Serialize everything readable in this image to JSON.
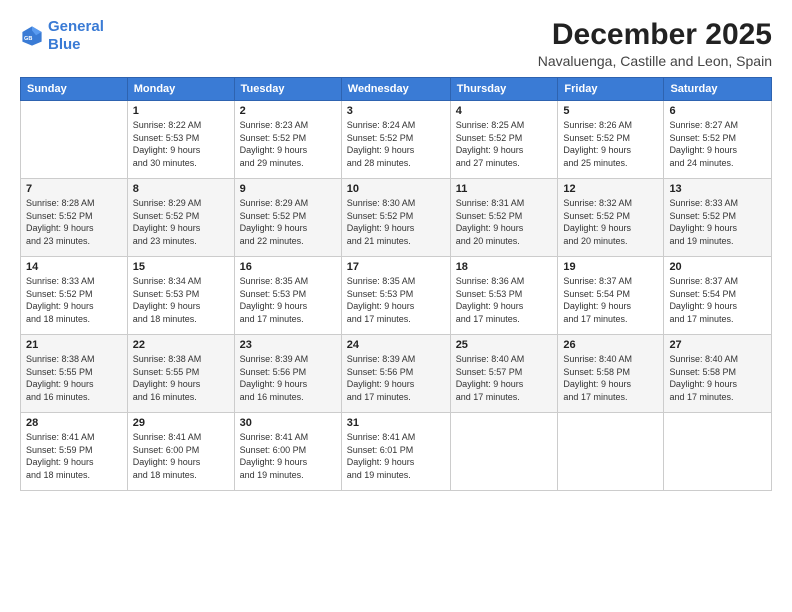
{
  "header": {
    "logo_line1": "General",
    "logo_line2": "Blue",
    "title": "December 2025",
    "subtitle": "Navaluenga, Castille and Leon, Spain"
  },
  "calendar": {
    "days_of_week": [
      "Sunday",
      "Monday",
      "Tuesday",
      "Wednesday",
      "Thursday",
      "Friday",
      "Saturday"
    ],
    "weeks": [
      [
        {
          "day": "",
          "info": ""
        },
        {
          "day": "1",
          "info": "Sunrise: 8:22 AM\nSunset: 5:53 PM\nDaylight: 9 hours\nand 30 minutes."
        },
        {
          "day": "2",
          "info": "Sunrise: 8:23 AM\nSunset: 5:52 PM\nDaylight: 9 hours\nand 29 minutes."
        },
        {
          "day": "3",
          "info": "Sunrise: 8:24 AM\nSunset: 5:52 PM\nDaylight: 9 hours\nand 28 minutes."
        },
        {
          "day": "4",
          "info": "Sunrise: 8:25 AM\nSunset: 5:52 PM\nDaylight: 9 hours\nand 27 minutes."
        },
        {
          "day": "5",
          "info": "Sunrise: 8:26 AM\nSunset: 5:52 PM\nDaylight: 9 hours\nand 25 minutes."
        },
        {
          "day": "6",
          "info": "Sunrise: 8:27 AM\nSunset: 5:52 PM\nDaylight: 9 hours\nand 24 minutes."
        }
      ],
      [
        {
          "day": "7",
          "info": "Sunrise: 8:28 AM\nSunset: 5:52 PM\nDaylight: 9 hours\nand 23 minutes."
        },
        {
          "day": "8",
          "info": "Sunrise: 8:29 AM\nSunset: 5:52 PM\nDaylight: 9 hours\nand 23 minutes."
        },
        {
          "day": "9",
          "info": "Sunrise: 8:29 AM\nSunset: 5:52 PM\nDaylight: 9 hours\nand 22 minutes."
        },
        {
          "day": "10",
          "info": "Sunrise: 8:30 AM\nSunset: 5:52 PM\nDaylight: 9 hours\nand 21 minutes."
        },
        {
          "day": "11",
          "info": "Sunrise: 8:31 AM\nSunset: 5:52 PM\nDaylight: 9 hours\nand 20 minutes."
        },
        {
          "day": "12",
          "info": "Sunrise: 8:32 AM\nSunset: 5:52 PM\nDaylight: 9 hours\nand 20 minutes."
        },
        {
          "day": "13",
          "info": "Sunrise: 8:33 AM\nSunset: 5:52 PM\nDaylight: 9 hours\nand 19 minutes."
        }
      ],
      [
        {
          "day": "14",
          "info": "Sunrise: 8:33 AM\nSunset: 5:52 PM\nDaylight: 9 hours\nand 18 minutes."
        },
        {
          "day": "15",
          "info": "Sunrise: 8:34 AM\nSunset: 5:53 PM\nDaylight: 9 hours\nand 18 minutes."
        },
        {
          "day": "16",
          "info": "Sunrise: 8:35 AM\nSunset: 5:53 PM\nDaylight: 9 hours\nand 17 minutes."
        },
        {
          "day": "17",
          "info": "Sunrise: 8:35 AM\nSunset: 5:53 PM\nDaylight: 9 hours\nand 17 minutes."
        },
        {
          "day": "18",
          "info": "Sunrise: 8:36 AM\nSunset: 5:53 PM\nDaylight: 9 hours\nand 17 minutes."
        },
        {
          "day": "19",
          "info": "Sunrise: 8:37 AM\nSunset: 5:54 PM\nDaylight: 9 hours\nand 17 minutes."
        },
        {
          "day": "20",
          "info": "Sunrise: 8:37 AM\nSunset: 5:54 PM\nDaylight: 9 hours\nand 17 minutes."
        }
      ],
      [
        {
          "day": "21",
          "info": "Sunrise: 8:38 AM\nSunset: 5:55 PM\nDaylight: 9 hours\nand 16 minutes."
        },
        {
          "day": "22",
          "info": "Sunrise: 8:38 AM\nSunset: 5:55 PM\nDaylight: 9 hours\nand 16 minutes."
        },
        {
          "day": "23",
          "info": "Sunrise: 8:39 AM\nSunset: 5:56 PM\nDaylight: 9 hours\nand 16 minutes."
        },
        {
          "day": "24",
          "info": "Sunrise: 8:39 AM\nSunset: 5:56 PM\nDaylight: 9 hours\nand 17 minutes."
        },
        {
          "day": "25",
          "info": "Sunrise: 8:40 AM\nSunset: 5:57 PM\nDaylight: 9 hours\nand 17 minutes."
        },
        {
          "day": "26",
          "info": "Sunrise: 8:40 AM\nSunset: 5:58 PM\nDaylight: 9 hours\nand 17 minutes."
        },
        {
          "day": "27",
          "info": "Sunrise: 8:40 AM\nSunset: 5:58 PM\nDaylight: 9 hours\nand 17 minutes."
        }
      ],
      [
        {
          "day": "28",
          "info": "Sunrise: 8:41 AM\nSunset: 5:59 PM\nDaylight: 9 hours\nand 18 minutes."
        },
        {
          "day": "29",
          "info": "Sunrise: 8:41 AM\nSunset: 6:00 PM\nDaylight: 9 hours\nand 18 minutes."
        },
        {
          "day": "30",
          "info": "Sunrise: 8:41 AM\nSunset: 6:00 PM\nDaylight: 9 hours\nand 19 minutes."
        },
        {
          "day": "31",
          "info": "Sunrise: 8:41 AM\nSunset: 6:01 PM\nDaylight: 9 hours\nand 19 minutes."
        },
        {
          "day": "",
          "info": ""
        },
        {
          "day": "",
          "info": ""
        },
        {
          "day": "",
          "info": ""
        }
      ]
    ]
  }
}
